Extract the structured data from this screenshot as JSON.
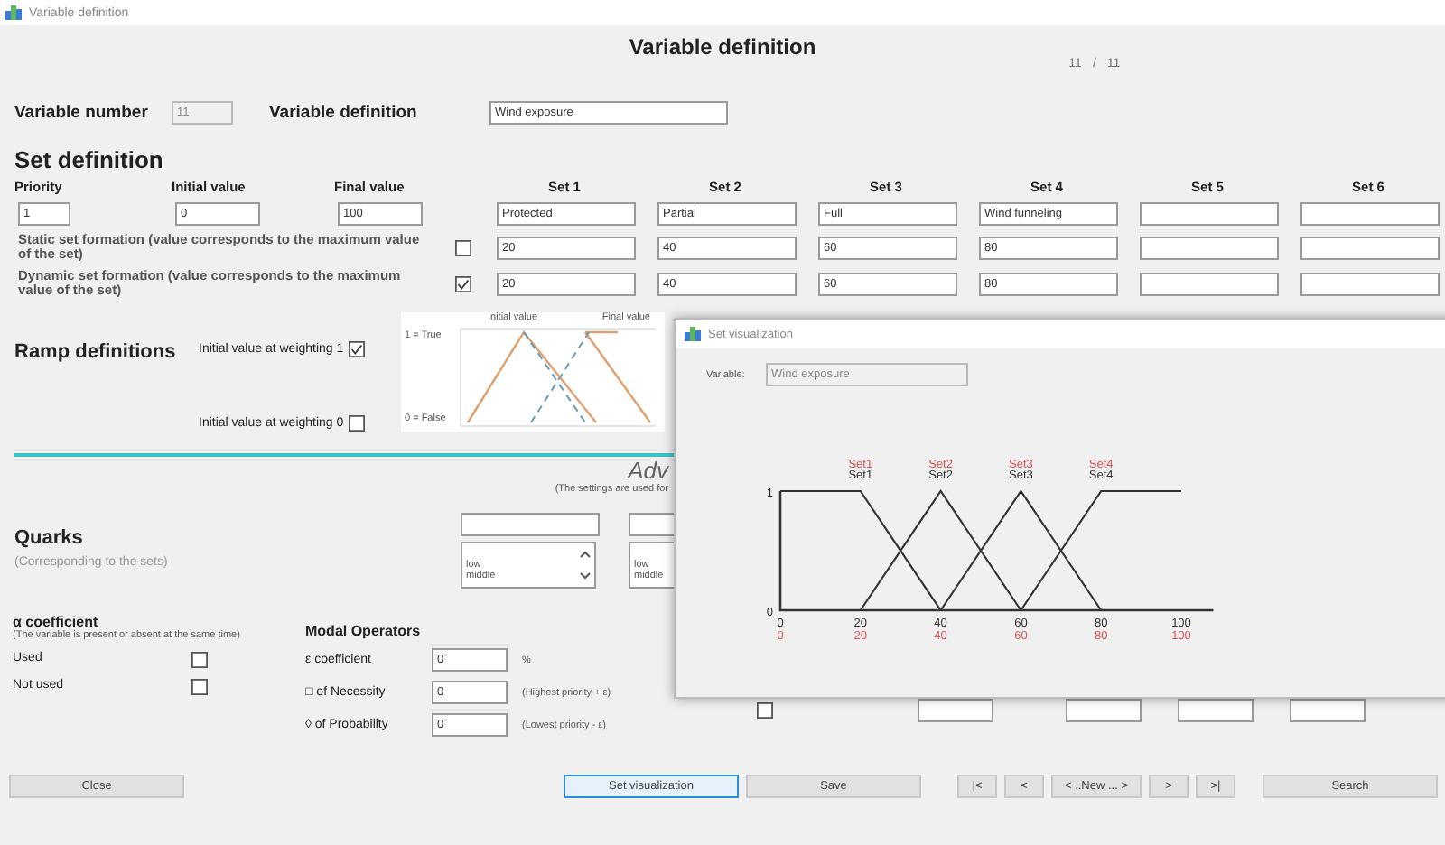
{
  "window": {
    "title": "Variable definition"
  },
  "heading": "Variable definition",
  "record_counter": {
    "current": "11",
    "separator": "/",
    "total": "11"
  },
  "variable": {
    "number_label": "Variable number",
    "number": "11",
    "definition_label": "Variable definition",
    "definition": "Wind exposure"
  },
  "set_definition": {
    "title": "Set definition",
    "priority_label": "Priority",
    "initial_label": "Initial value",
    "final_label": "Final value",
    "priority": "1",
    "initial": "0",
    "final": "100",
    "sets": [
      {
        "header": "Set 1",
        "name": "Protected",
        "static": "20",
        "dynamic": "20"
      },
      {
        "header": "Set 2",
        "name": "Partial",
        "static": "40",
        "dynamic": "40"
      },
      {
        "header": "Set 3",
        "name": "Full",
        "static": "60",
        "dynamic": "60"
      },
      {
        "header": "Set 4",
        "name": "Wind funneling",
        "static": "80",
        "dynamic": "80"
      },
      {
        "header": "Set 5"
      },
      {
        "header": "Set 6"
      }
    ],
    "static_row": {
      "label": "Static set formation (value corresponds to the maximum value of the set)",
      "checked": false
    },
    "dynamic_row": {
      "label": "Dynamic set formation (value corresponds to the maximum value of the set)",
      "checked": true
    }
  },
  "ramp": {
    "title": "Ramp definitions",
    "options": [
      {
        "label": "Initial value at weighting 1",
        "checked": true
      },
      {
        "label": "Initial value at weighting 0",
        "checked": false
      }
    ],
    "diagram": {
      "initial_label": "Initial value",
      "final_label": "Final value",
      "true_label": "1 = True",
      "false_label": "0 = False"
    }
  },
  "advanced": {
    "title": "Adv",
    "note": "(The settings are used for"
  },
  "quarks": {
    "title": "Quarks",
    "subtitle": "(Corresponding to the sets)",
    "lists": [
      {
        "items": [
          "low",
          "middle"
        ]
      },
      {
        "items": [
          "low",
          "middle"
        ]
      }
    ]
  },
  "alpha": {
    "title": "α coefficient",
    "note": "(The variable is present or absent at the same time)",
    "options": [
      {
        "label": "Used",
        "checked": false
      },
      {
        "label": "Not used",
        "checked": false
      }
    ]
  },
  "modal": {
    "title": "Modal Operators",
    "rows": [
      {
        "label": "ε coefficient",
        "value": "0",
        "note": "%"
      },
      {
        "label": "□  of Necessity",
        "value": "0",
        "note": "(Highest priority + ε)"
      },
      {
        "label": "◊  of Probability",
        "value": "0",
        "note": "(Lowest priority - ε)"
      }
    ]
  },
  "distribution_row": {
    "checked": false
  },
  "buttons": [
    {
      "label": "Close",
      "kind": "wide",
      "focused": false
    },
    {
      "label": "Set visualization",
      "kind": "wide",
      "focused": true
    },
    {
      "label": "Save",
      "kind": "wide",
      "focused": false
    },
    {
      "label": "|<",
      "kind": "nav",
      "focused": false
    },
    {
      "label": "<",
      "kind": "nav",
      "focused": false
    },
    {
      "label": "< ..New ... >",
      "kind": "new",
      "focused": false
    },
    {
      "label": ">",
      "kind": "nav",
      "focused": false
    },
    {
      "label": ">|",
      "kind": "nav",
      "focused": false
    },
    {
      "label": "Search",
      "kind": "wide",
      "focused": false
    }
  ],
  "popup": {
    "title": "Set visualization",
    "variable_label": "Variable:",
    "variable": "Wind exposure",
    "set_labels": [
      "Set1",
      "Set2",
      "Set3",
      "Set4"
    ],
    "limit_labels": [
      "0",
      "20",
      "40",
      "60",
      "80",
      "100"
    ],
    "chart_data": {
      "type": "line",
      "x": [
        0,
        20,
        40,
        60,
        80,
        100
      ],
      "xlim": [
        0,
        108
      ],
      "ylim": [
        0,
        1
      ],
      "xticks": [
        0,
        20,
        40,
        60,
        80,
        100
      ],
      "yticks": [
        0,
        1
      ],
      "series": [
        {
          "name": "Set1",
          "color": "#333333",
          "values": [
            1,
            1,
            0,
            null,
            null,
            null
          ]
        },
        {
          "name": "Set2",
          "color": "#333333",
          "values": [
            null,
            0,
            1,
            0,
            null,
            null
          ]
        },
        {
          "name": "Set3",
          "color": "#333333",
          "values": [
            null,
            null,
            0,
            1,
            0,
            null
          ]
        },
        {
          "name": "Set4",
          "color": "#333333",
          "values": [
            null,
            null,
            null,
            0,
            1,
            1
          ]
        }
      ]
    }
  }
}
